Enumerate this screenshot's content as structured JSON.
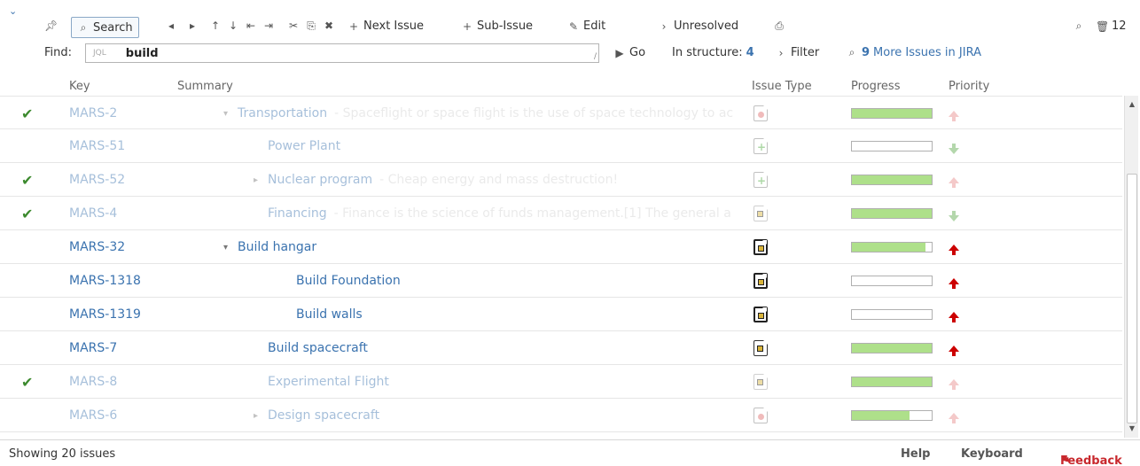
{
  "toolbar": {
    "collapse_icon": "chevron-down-icon",
    "pin_icon": "pin-icon",
    "search_label": "Search",
    "next_issue_label": "Next Issue",
    "sub_issue_label": "Sub-Issue",
    "edit_label": "Edit",
    "resolution_label": "Unresolved",
    "zoom_icon": "magnifier-icon",
    "trash_count": "12",
    "find_label": "Find:",
    "jql_tag": "JQL",
    "find_value": "build",
    "go_label": "Go",
    "in_structure_label": "In structure:",
    "in_structure_count": "4",
    "filter_label": "Filter",
    "more_issues_count": "9",
    "more_issues_label": "More Issues in JIRA"
  },
  "columns": {
    "key": "Key",
    "summary": "Summary",
    "issue_type": "Issue Type",
    "progress": "Progress",
    "priority": "Priority"
  },
  "rows": [
    {
      "resolved": true,
      "key": "MARS-2",
      "indent": 1,
      "arrow": "▾",
      "title": "Transportation",
      "desc": "-  Spaceflight or space flight is the use of space technology to ac",
      "type": "epic",
      "progress": 1.0,
      "priority": "up-light"
    },
    {
      "resolved": true,
      "key": "MARS-51",
      "indent": 2,
      "arrow": "",
      "title": "Power Plant",
      "desc": "",
      "type": "feature",
      "progress": 0.0,
      "priority": "down"
    },
    {
      "resolved": true,
      "key": "MARS-52",
      "indent": 2,
      "arrow": "▸",
      "title": "Nuclear program",
      "desc": "-  Cheap energy and mass destruction!",
      "type": "feature",
      "progress": 1.0,
      "priority": "up-light"
    },
    {
      "resolved": true,
      "key": "MARS-4",
      "indent": 2,
      "arrow": "",
      "title": "Financing",
      "desc": "-  Finance is the science of funds management.[1] The general a",
      "type": "task-light",
      "progress": 1.0,
      "priority": "down"
    },
    {
      "resolved": false,
      "key": "MARS-32",
      "indent": 1,
      "arrow": "▾",
      "title": "Build hangar",
      "desc": "",
      "type": "task",
      "progress": 0.92,
      "priority": "up"
    },
    {
      "resolved": false,
      "key": "MARS-1318",
      "indent": 3,
      "arrow": "",
      "title": "Build Foundation",
      "desc": "",
      "type": "task",
      "progress": 0.0,
      "priority": "up"
    },
    {
      "resolved": false,
      "key": "MARS-1319",
      "indent": 3,
      "arrow": "",
      "title": "Build walls",
      "desc": "",
      "type": "task",
      "progress": 0.0,
      "priority": "up"
    },
    {
      "resolved": false,
      "key": "MARS-7",
      "indent": 2,
      "arrow": "",
      "title": "Build spacecraft",
      "desc": "",
      "type": "task-yellow",
      "progress": 1.0,
      "priority": "up"
    },
    {
      "resolved": true,
      "key": "MARS-8",
      "indent": 2,
      "arrow": "",
      "title": "Experimental Flight",
      "desc": "",
      "type": "task-light",
      "progress": 1.0,
      "priority": "up-light"
    },
    {
      "resolved": true,
      "key": "MARS-6",
      "indent": 2,
      "arrow": "▸",
      "title": "Design spacecraft",
      "desc": "",
      "type": "epic",
      "progress": 0.72,
      "priority": "up-light"
    }
  ],
  "footer": {
    "status": "Showing 20 issues",
    "help": "Help",
    "keyboard": "Keyboard",
    "feedback": "Feedback"
  },
  "colors": {
    "link": "#3b73af",
    "progress_fill": "#aee08a",
    "check": "#3c8a2e",
    "priority_high": "#cc0000",
    "priority_low": "#5aa84a",
    "feedback": "#c8282d"
  }
}
